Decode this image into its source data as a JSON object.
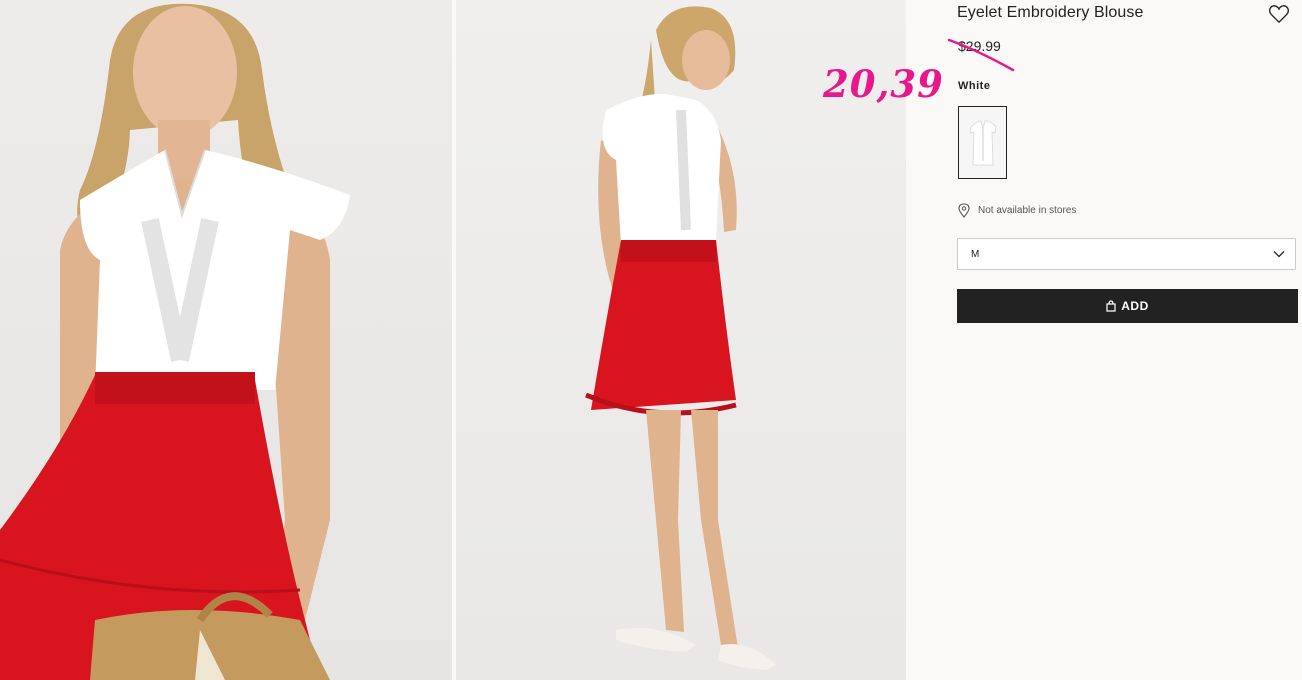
{
  "product": {
    "title": "Eyelet Embroidery Blouse",
    "original_price": "$29.99",
    "sale_price_handwritten": "20,39",
    "sale_color": "#e8188c",
    "color_name": "White",
    "availability": "Not available in stores",
    "selected_size": "M",
    "add_label": "ADD"
  },
  "icons": {
    "favorite": "heart-outline-icon",
    "location": "map-pin-icon",
    "dropdown": "chevron-down-icon",
    "bag": "shopping-bag-icon"
  },
  "colors": {
    "skirt": "#d8141f",
    "blouse": "#ffffff",
    "button": "#222222",
    "page_bg": "#faf9f8"
  }
}
